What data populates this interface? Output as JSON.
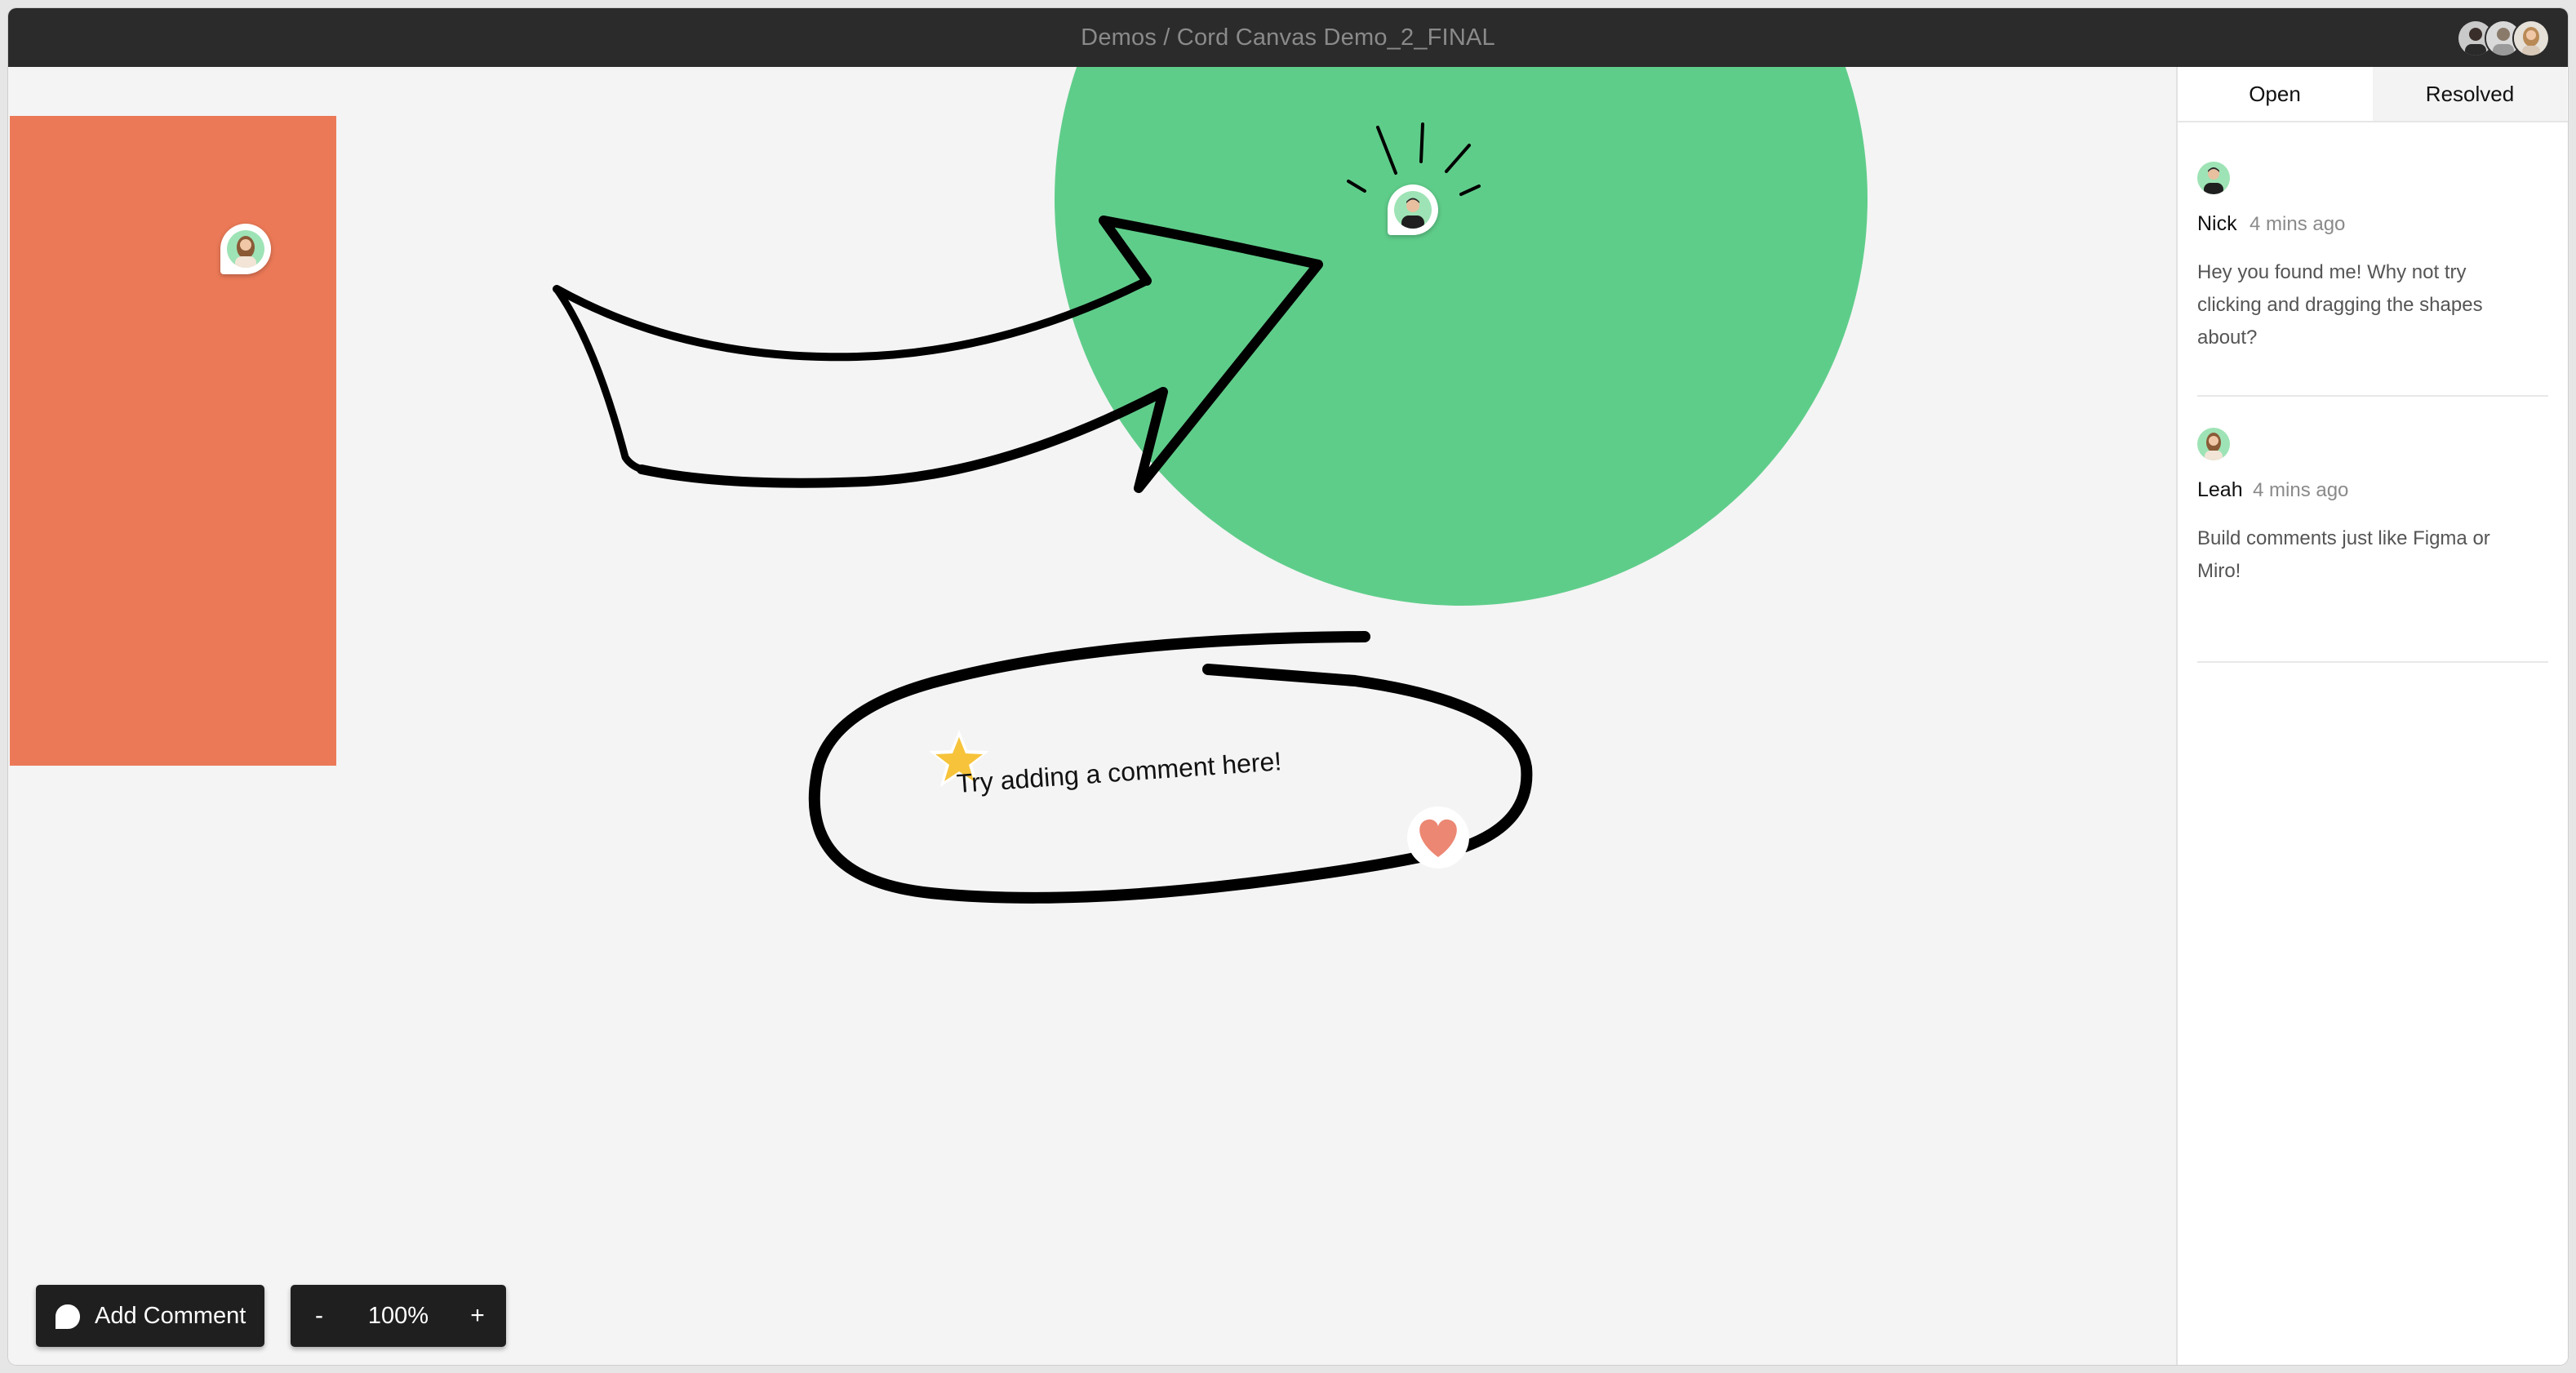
{
  "window": {
    "title": "Demos / Cord Canvas Demo_2_FINAL",
    "presence": [
      "user-avatar-1",
      "user-avatar-2",
      "user-avatar-3"
    ]
  },
  "canvas": {
    "hint_text": "Try adding a comment here!",
    "shapes": {
      "rectangle_color": "#EB7957",
      "circle_color": "#5FCD8A",
      "stroke_color": "#000000"
    },
    "stickers": [
      "star-icon",
      "heart-icon"
    ]
  },
  "toolbar": {
    "add_comment_label": "Add Comment",
    "zoom_out_label": "-",
    "zoom_value": "100%",
    "zoom_in_label": "+"
  },
  "sidebar": {
    "tabs": [
      {
        "label": "Open",
        "active": true
      },
      {
        "label": "Resolved",
        "active": false
      }
    ],
    "threads": [
      {
        "name": "Nick",
        "time": "4 mins ago",
        "body": "Hey you found me! Why not try clicking and dragging the shapes about?"
      },
      {
        "name": "Leah",
        "time": "4 mins ago",
        "body": "Build comments just like Figma or Miro!"
      }
    ]
  },
  "colors": {
    "titlebar": "#2B2B2B",
    "canvas": "#F4F4F4",
    "button": "#1F1F1F",
    "avatar_bg": "#9EE3B5"
  }
}
